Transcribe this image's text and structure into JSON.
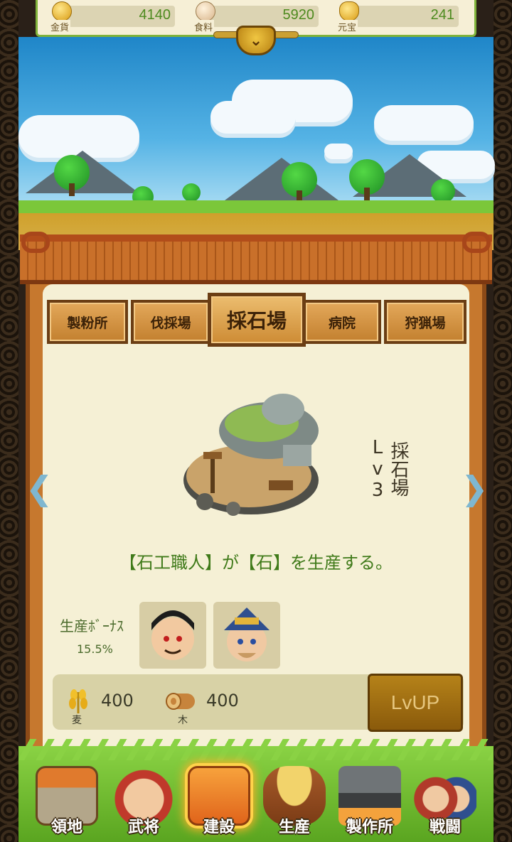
{
  "resources": [
    {
      "label": "金貨",
      "value": "4140"
    },
    {
      "label": "食料",
      "value": "5920"
    },
    {
      "label": "元宝",
      "value": "241"
    }
  ],
  "toggle_icon": "chevron-down-icon",
  "tabs": [
    {
      "label": "製粉所",
      "active": false
    },
    {
      "label": "伐採場",
      "active": false
    },
    {
      "label": "採石場",
      "active": true
    },
    {
      "label": "病院",
      "active": false
    },
    {
      "label": "狩猟場",
      "active": false
    }
  ],
  "building": {
    "level_text": "採石場Lv3",
    "description": "【石工職人】が【石】を生産する。",
    "bonus_label": "生産ﾎﾞｰﾅｽ",
    "bonus_value": "15.5%"
  },
  "cost": [
    {
      "label": "麦",
      "value": "400",
      "icon": "wheat-icon"
    },
    {
      "label": "木",
      "value": "400",
      "icon": "wood-log-icon"
    }
  ],
  "lvup_label": "LvUP",
  "nav": [
    {
      "label": "領地",
      "icon": "castle-icon",
      "active": false
    },
    {
      "label": "武将",
      "icon": "general-icon",
      "active": false
    },
    {
      "label": "建設",
      "icon": "hammer-icon",
      "active": true
    },
    {
      "label": "生産",
      "icon": "grain-barrel-icon",
      "active": false
    },
    {
      "label": "製作所",
      "icon": "anvil-icon",
      "active": false
    },
    {
      "label": "戦闘",
      "icon": "warriors-icon",
      "active": false
    }
  ],
  "colors": {
    "accent_green": "#4d8a1e",
    "wood": "#c3802f",
    "panel": "#f5f0d5"
  }
}
